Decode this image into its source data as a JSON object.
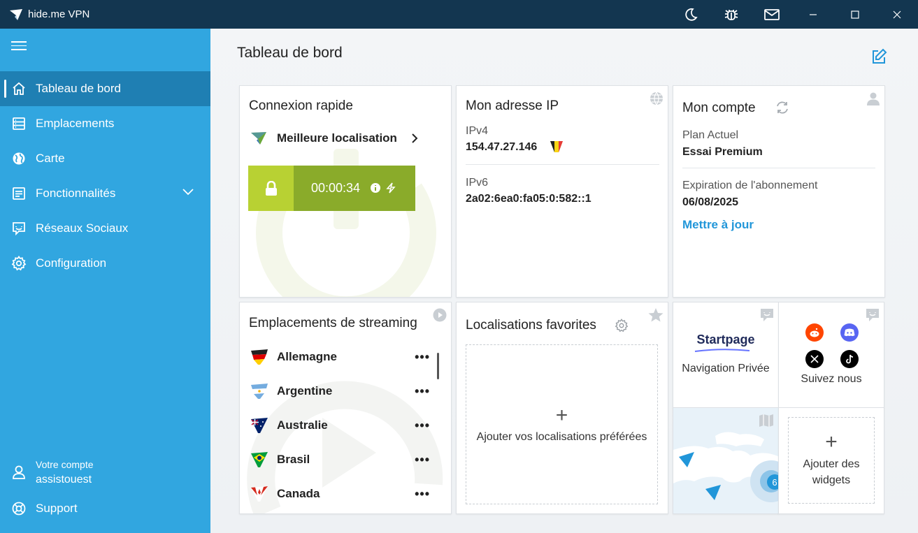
{
  "window": {
    "title": "hide.me VPN"
  },
  "sidebar": {
    "items": [
      {
        "label": "Tableau de bord",
        "icon": "home-icon"
      },
      {
        "label": "Emplacements",
        "icon": "server-list-icon"
      },
      {
        "label": "Carte",
        "icon": "globe-icon"
      },
      {
        "label": "Fonctionnalités",
        "icon": "features-icon"
      },
      {
        "label": "Réseaux Sociaux",
        "icon": "chat-icon"
      },
      {
        "label": "Configuration",
        "icon": "gear-icon"
      }
    ],
    "account": {
      "label": "Votre compte",
      "username": "assistouest"
    },
    "support": {
      "label": "Support"
    }
  },
  "main": {
    "title": "Tableau de bord"
  },
  "quick_connect": {
    "title": "Connexion rapide",
    "location": "Meilleure localisation",
    "timer": "00:00:34"
  },
  "ip": {
    "title": "Mon adresse IP",
    "ipv4_label": "IPv4",
    "ipv4_value": "154.47.27.146",
    "ipv6_label": "IPv6",
    "ipv6_value": "2a02:6ea0:fa05:0:582::1"
  },
  "account_card": {
    "title": "Mon compte",
    "plan_label": "Plan Actuel",
    "plan_value": "Essai Premium",
    "expiry_label": "Expiration de l'abonnement",
    "expiry_value": "06/08/2025",
    "upgrade_label": "Mettre à jour"
  },
  "streaming": {
    "title": "Emplacements de streaming",
    "items": [
      {
        "name": "Allemagne",
        "more": "•••"
      },
      {
        "name": "Argentine",
        "more": "•••"
      },
      {
        "name": "Australie",
        "more": "•••"
      },
      {
        "name": "Brasil",
        "more": "•••"
      },
      {
        "name": "Canada",
        "more": "•••"
      }
    ]
  },
  "favorites": {
    "title": "Localisations favorites",
    "plus": "+",
    "empty_text": "Ajouter vos localisations préférées"
  },
  "widgets": {
    "startpage_logo": "Startpage",
    "startpage_label": "Navigation Privée",
    "follow_label": "Suivez nous",
    "map_badge": "6",
    "add_plus": "+",
    "add_label": "Ajouter des widgets"
  },
  "colors": {
    "titlebar": "#133650",
    "sidebar": "#31a6e0",
    "sidebar_active": "#1f7fb3",
    "accent": "#2196d9",
    "connect_dark": "#8aab2a",
    "connect_light": "#b8d133"
  }
}
